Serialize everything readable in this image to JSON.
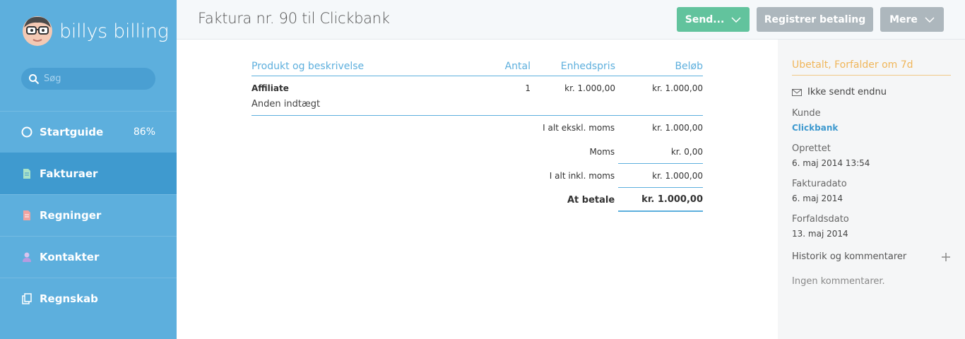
{
  "app": {
    "brand": "billys billing"
  },
  "search": {
    "placeholder": "Søg"
  },
  "nav": [
    {
      "label": "Startguide",
      "icon": "progress-ring-icon",
      "extra": "86%"
    },
    {
      "label": "Fakturaer",
      "icon": "invoice-icon",
      "active": true
    },
    {
      "label": "Regninger",
      "icon": "bill-icon"
    },
    {
      "label": "Kontakter",
      "icon": "contact-icon"
    },
    {
      "label": "Regnskab",
      "icon": "accounting-icon"
    }
  ],
  "header": {
    "title": "Faktura nr. 90 til Clickbank",
    "send_label": "Send...",
    "register_label": "Registrer betaling",
    "more_label": "Mere"
  },
  "invoice": {
    "columns": {
      "desc": "Produkt og beskrivelse",
      "qty": "Antal",
      "unit": "Enhedspris",
      "amount": "Beløb"
    },
    "line": {
      "product": "Affiliate",
      "description": "Anden indtægt",
      "qty": "1",
      "unit": "kr. 1.000,00",
      "amount": "kr. 1.000,00"
    },
    "totals": {
      "excl_label": "I alt ekskl. moms",
      "excl_value": "kr. 1.000,00",
      "vat_label": "Moms",
      "vat_value": "kr. 0,00",
      "incl_label": "I alt inkl. moms",
      "incl_value": "kr. 1.000,00",
      "due_label": "At betale",
      "due_value": "kr. 1.000,00"
    }
  },
  "panel": {
    "status": "Ubetalt, Forfalder om 7d",
    "not_sent": "Ikke sendt endnu",
    "customer_label": "Kunde",
    "customer": "Clickbank",
    "created_label": "Oprettet",
    "created": "6. maj 2014 13:54",
    "invoice_date_label": "Fakturadato",
    "invoice_date": "6. maj 2014",
    "due_date_label": "Forfaldsdato",
    "due_date": "13. maj 2014",
    "history_label": "Historik og kommentarer",
    "no_comments": "Ingen kommentarer."
  },
  "colors": {
    "sidebar": "#5dafdd",
    "active": "#3f9acf",
    "send": "#62c39d",
    "status": "#f0b65a"
  }
}
